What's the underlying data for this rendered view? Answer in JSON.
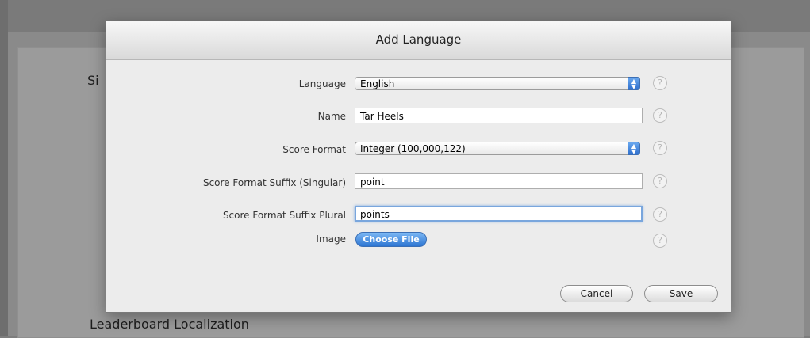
{
  "background": {
    "partial_text_left": "Si",
    "section_heading": "Leaderboard Localization"
  },
  "dialog": {
    "title": "Add Language",
    "fields": {
      "language": {
        "label": "Language",
        "value": "English"
      },
      "name": {
        "label": "Name",
        "value": "Tar Heels"
      },
      "score_format": {
        "label": "Score Format",
        "value": "Integer (100,000,122)"
      },
      "suffix_singular": {
        "label": "Score Format Suffix (Singular)",
        "value": "point"
      },
      "suffix_plural": {
        "label": "Score Format Suffix Plural",
        "value": "points"
      },
      "image": {
        "label": "Image",
        "button": "Choose File"
      }
    },
    "help_icon_glyph": "?",
    "buttons": {
      "cancel": "Cancel",
      "save": "Save"
    }
  },
  "colors": {
    "accent_blue": "#2f70cf",
    "focus_ring": "#79a6dd"
  }
}
